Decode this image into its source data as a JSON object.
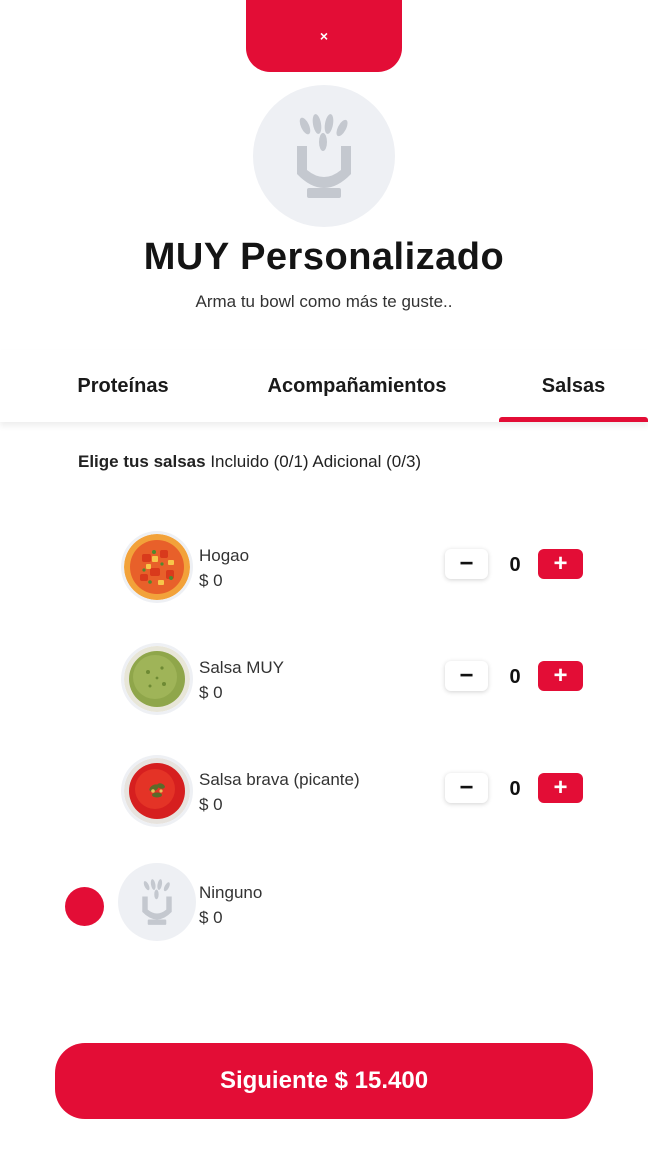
{
  "close_icon": "×",
  "header": {
    "title": "MUY Personalizado",
    "subtitle": "Arma tu bowl como más te guste.."
  },
  "tabs": [
    {
      "label": "Proteínas",
      "active": false
    },
    {
      "label": "Acompañamientos",
      "active": false
    },
    {
      "label": "Salsas",
      "active": true
    }
  ],
  "section": {
    "title": "Elige tus salsas",
    "included": "Incluido (0/1)",
    "additional": "Adicional (0/3)"
  },
  "items": [
    {
      "name": "Hogao",
      "price": "$ 0",
      "qty": "0",
      "image": "hogao-image"
    },
    {
      "name": "Salsa MUY",
      "price": "$ 0",
      "qty": "0",
      "image": "salsa-muy-image"
    },
    {
      "name": "Salsa brava (picante)",
      "price": "$ 0",
      "qty": "0",
      "image": "salsa-brava-image"
    },
    {
      "name": "Ninguno",
      "price": "$ 0",
      "selected": true,
      "image": "muy-logo-icon"
    }
  ],
  "minus_label": "−",
  "plus_label": "+",
  "next_button": "Siguiente $ 15.400",
  "colors": {
    "accent": "#e30d36",
    "placeholder_bg": "#eef0f4",
    "logo_gray": "#c4c8cf"
  }
}
